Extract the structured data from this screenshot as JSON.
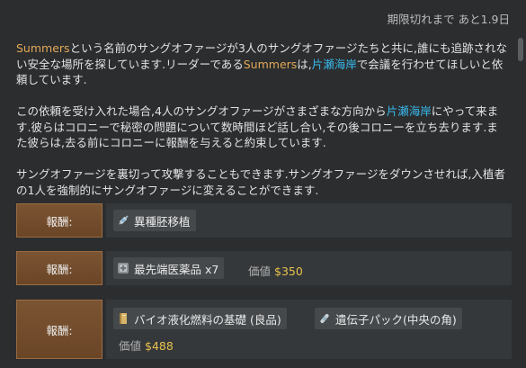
{
  "header": {
    "expiry": "期限切れまで あと1.9日"
  },
  "description": {
    "p1_name": "Summers",
    "p1_a": "という名前のサングオファージが3人のサングオファージたちと共に,誰にも追跡されない安全な場所を探しています.リーダーである",
    "p1_name2": "Summers",
    "p1_b": "は,",
    "p1_place": "片瀬海岸",
    "p1_c": "で会議を行わせてほしいと依頼しています.",
    "p2_a": "この依頼を受け入れた場合,4人のサングオファージがさまざまな方向から",
    "p2_place": "片瀬海岸",
    "p2_b": "にやって来ます.彼らはコロニーで秘密の問題について数時間ほど話し合い,その後コロニーを立ち去ります.また彼らは,去る前にコロニーに報酬を与えると約束しています.",
    "p3": "サングオファージを裏切って攻撃することもできます.サングオファージをダウンさせれば,入植者の1人を強制的にサングオファージに変えることができます."
  },
  "rewards": [
    {
      "button": "報酬:",
      "items": [
        {
          "label": "異種胚移植",
          "icon": "syringe-icon"
        }
      ],
      "value_label": "",
      "value": ""
    },
    {
      "button": "報酬:",
      "items": [
        {
          "label": "最先端医薬品 x7",
          "icon": "medicine-icon"
        }
      ],
      "value_label": "価値",
      "value": "$350"
    },
    {
      "button": "報酬:",
      "items": [
        {
          "label": "バイオ液化燃料の基礎 (良品)",
          "icon": "book-icon"
        },
        {
          "label": "遺伝子パック(中央の角)",
          "icon": "genepack-icon"
        }
      ],
      "value_label": "価値",
      "value": "$488"
    }
  ],
  "colors": {
    "name": "#e3a857",
    "place": "#38b6e8",
    "money": "#e7c04d",
    "button": "#7b5432"
  }
}
